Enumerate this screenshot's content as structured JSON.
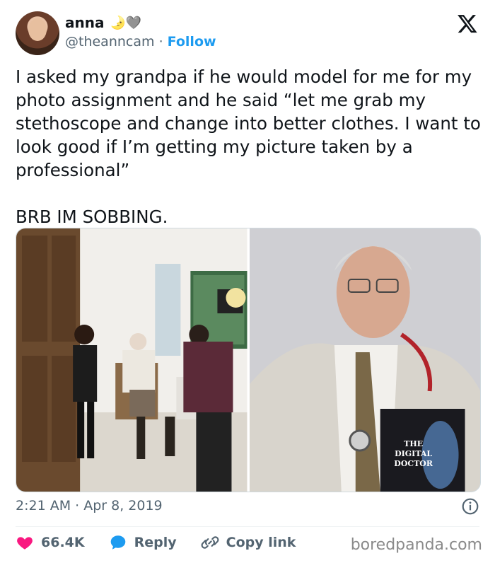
{
  "author": {
    "name": "anna",
    "emoji": "🌛🩶",
    "handle": "@theanncam",
    "separator": "·",
    "follow_label": "Follow"
  },
  "tweet": {
    "paragraph_1": "I asked my grandpa if he would model for me for my photo assignment and he said “let me grab my stethoscope and change into better clothes. I want to look good if I’m getting my picture taken by a professional”",
    "paragraph_2": "BRB IM SOBBING."
  },
  "media": {
    "book_title_line1": "THE",
    "book_title_line2": "DIGITAL",
    "book_title_line3": "DOCTOR"
  },
  "meta": {
    "timestamp": "2:21 AM · Apr 8, 2019"
  },
  "actions": {
    "like_count": "66.4K",
    "reply_label": "Reply",
    "copy_link_label": "Copy link"
  },
  "watermark": "boredpanda.com",
  "colors": {
    "accent": "#1d9bf0",
    "like": "#f91880",
    "secondary_text": "#536471"
  }
}
